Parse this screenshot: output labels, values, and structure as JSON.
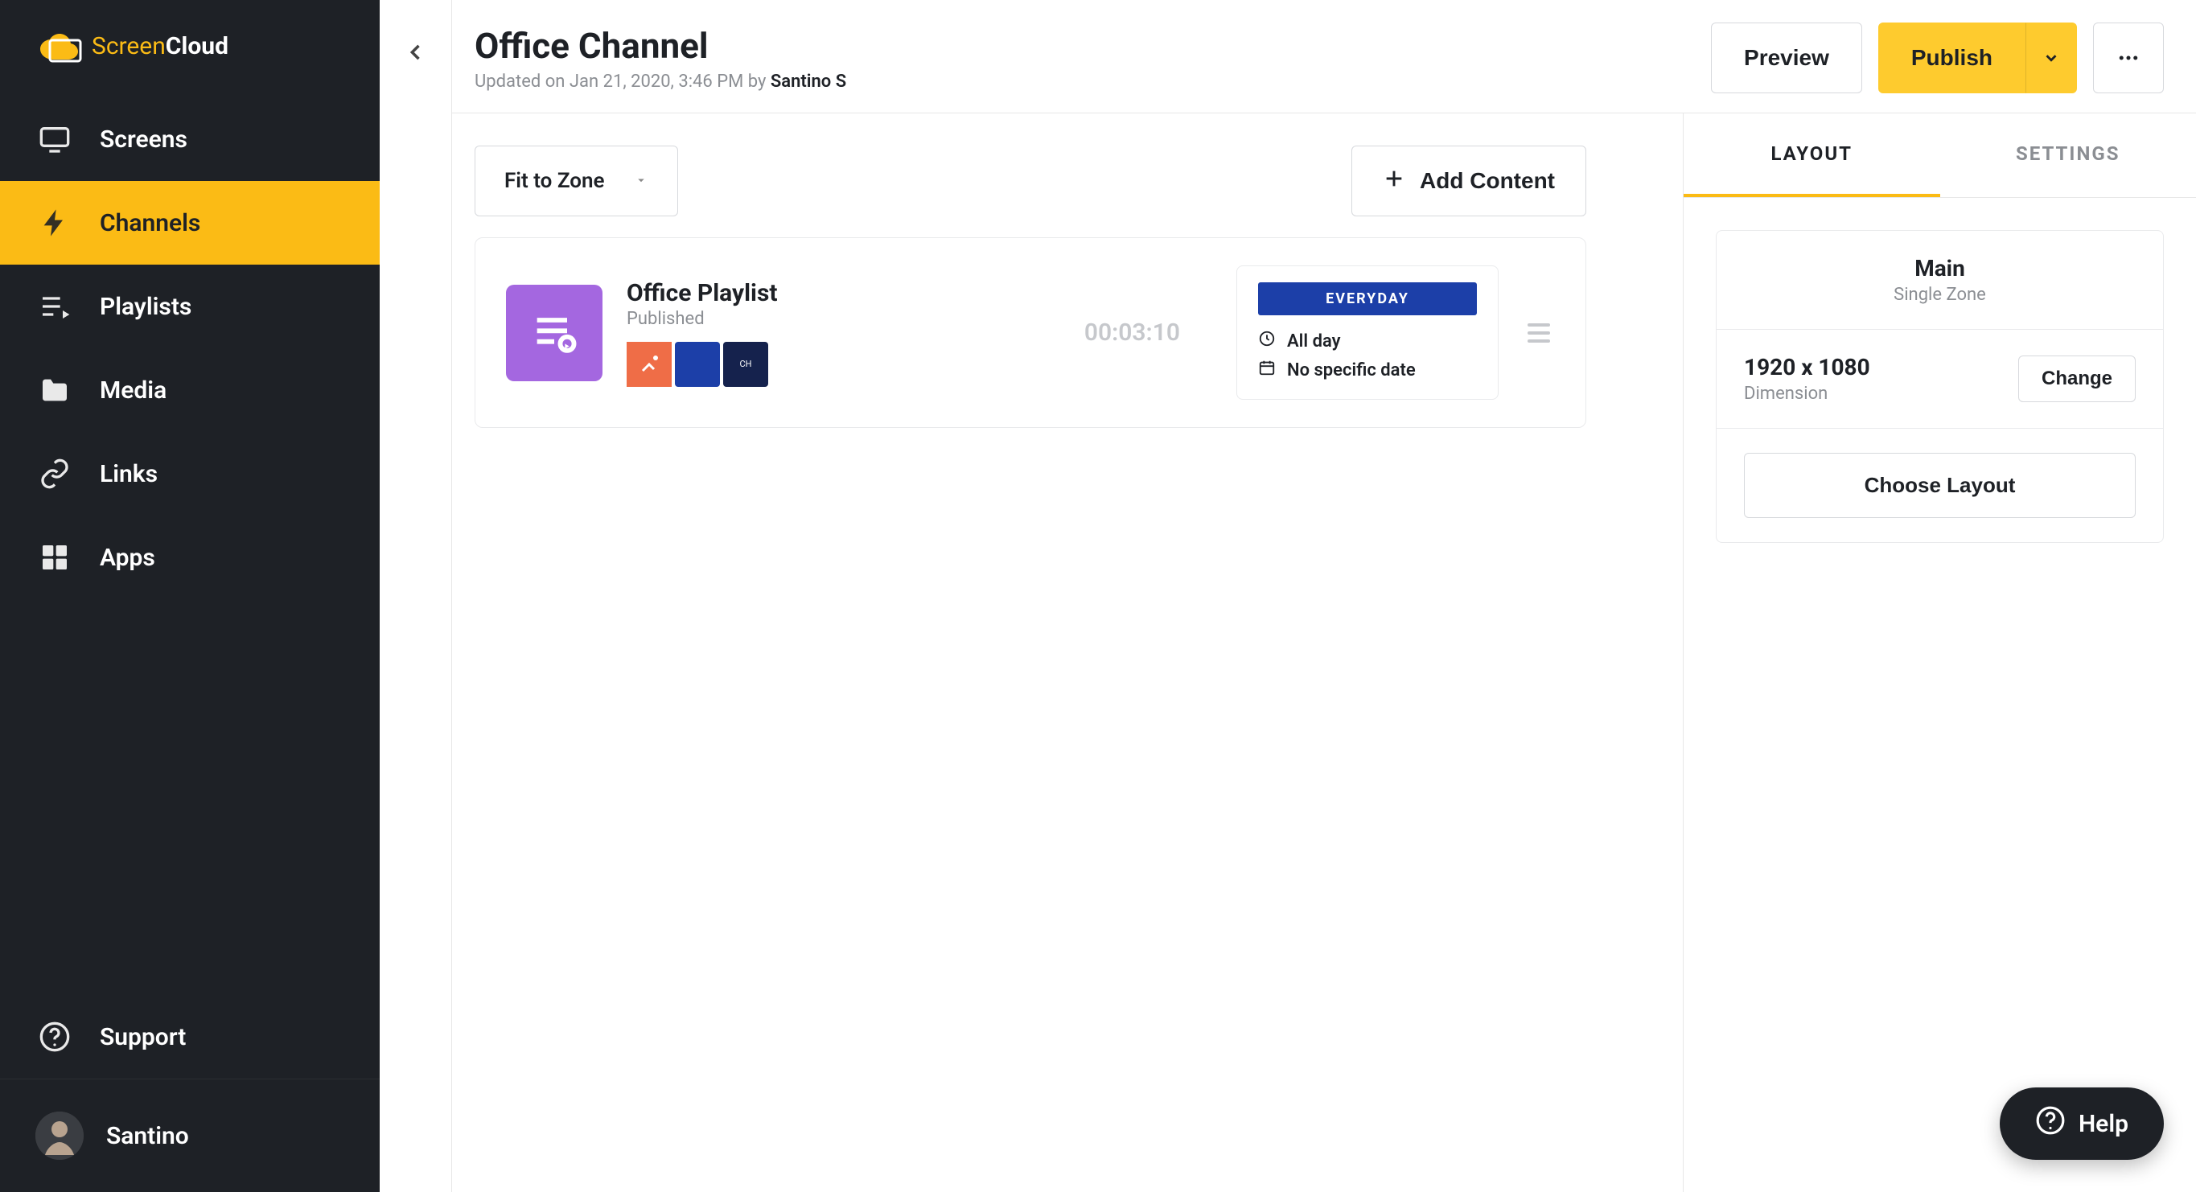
{
  "brand": {
    "prefix": "Screen",
    "suffix": "Cloud"
  },
  "sidebar": {
    "items": [
      {
        "id": "screens",
        "label": "Screens"
      },
      {
        "id": "channels",
        "label": "Channels"
      },
      {
        "id": "playlists",
        "label": "Playlists"
      },
      {
        "id": "media",
        "label": "Media"
      },
      {
        "id": "links",
        "label": "Links"
      },
      {
        "id": "apps",
        "label": "Apps"
      }
    ],
    "support_label": "Support",
    "user_name": "Santino"
  },
  "header": {
    "title": "Office Channel",
    "updated_prefix": "Updated on ",
    "updated_at": "Jan 21, 2020, 3:46 PM",
    "by_word": " by ",
    "author": "Santino S",
    "preview_label": "Preview",
    "publish_label": "Publish"
  },
  "canvas": {
    "fit_label": "Fit to Zone",
    "add_content_label": "Add Content",
    "playlist": {
      "title": "Office Playlist",
      "status": "Published",
      "duration": "00:03:10",
      "badge": "EVERYDAY",
      "line_allday": "All day",
      "line_nodate": "No specific date",
      "thumb_c_text": "CH"
    }
  },
  "rightpanel": {
    "tabs": {
      "layout": "LAYOUT",
      "settings": "SETTINGS"
    },
    "zone_name": "Main",
    "zone_type": "Single Zone",
    "dimension_value": "1920 x 1080",
    "dimension_label": "Dimension",
    "change_label": "Change",
    "choose_layout_label": "Choose Layout"
  },
  "help": {
    "label": "Help"
  }
}
